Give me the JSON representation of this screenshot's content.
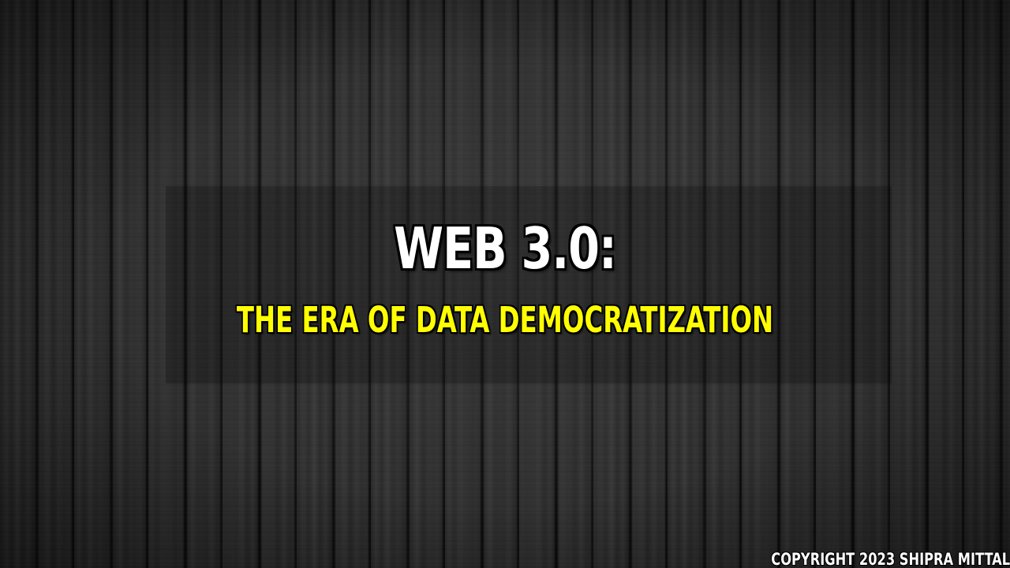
{
  "slide": {
    "title": "WEB 3.0:",
    "subtitle": "THE ERA OF DATA DEMOCRATIZATION",
    "copyright": "COPYRIGHT 2023 SHIPRA MITTAL"
  },
  "colors": {
    "title": "#ffffff",
    "subtitle": "#ffff00",
    "background": "#2a2a2a",
    "outline": "#000000"
  }
}
